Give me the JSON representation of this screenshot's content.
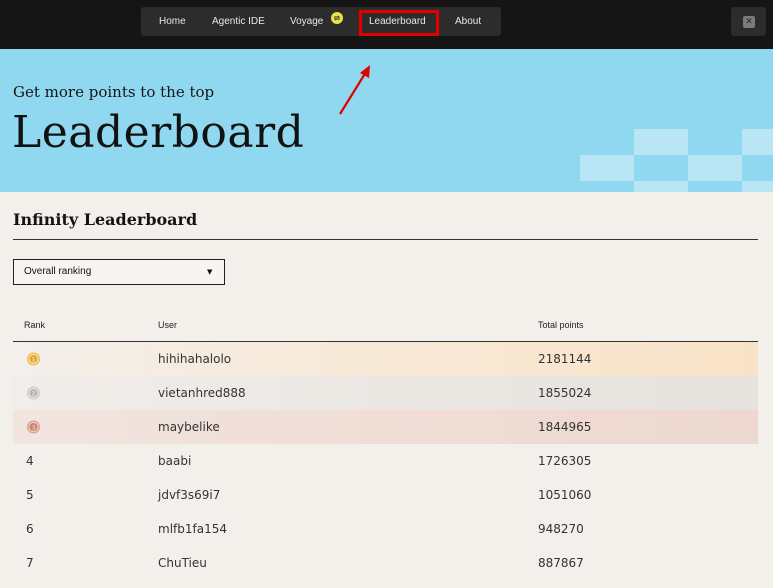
{
  "nav": {
    "items": [
      {
        "label": "Home"
      },
      {
        "label": "Agentic IDE"
      },
      {
        "label": "Voyage"
      },
      {
        "label": "Leaderboard"
      },
      {
        "label": "About"
      }
    ],
    "active": "Leaderboard",
    "highlight_color": "#e00000"
  },
  "social": {
    "icon": "x-icon"
  },
  "hero": {
    "subtitle": "Get more points to the top",
    "title": "Leaderboard"
  },
  "section": {
    "title": "Infinity Leaderboard"
  },
  "filter": {
    "selected": "Overall ranking",
    "icon": "caret-down-icon"
  },
  "table": {
    "columns": {
      "rank": "Rank",
      "user": "User",
      "points": "Total points"
    },
    "rows": [
      {
        "rank": "1",
        "user": "hihihahalolo",
        "points": "2181144",
        "medal": "gold-medal-icon"
      },
      {
        "rank": "2",
        "user": "vietanhred888",
        "points": "1855024",
        "medal": "silver-medal-icon"
      },
      {
        "rank": "3",
        "user": "maybelike",
        "points": "1844965",
        "medal": "bronze-medal-icon"
      },
      {
        "rank": "4",
        "user": "baabi",
        "points": "1726305"
      },
      {
        "rank": "5",
        "user": "jdvf3s69i7",
        "points": "1051060"
      },
      {
        "rank": "6",
        "user": "mlfb1fa154",
        "points": "948270"
      },
      {
        "rank": "7",
        "user": "ChuTieu",
        "points": "887867"
      }
    ]
  },
  "colors": {
    "topbar": "#151515",
    "hero": "#8fd8f0",
    "page_bg": "#f3efeb",
    "gold_row": "#f7e6d0",
    "silver_row": "#ebe7e3",
    "bronze_row": "#f0ddd6"
  }
}
